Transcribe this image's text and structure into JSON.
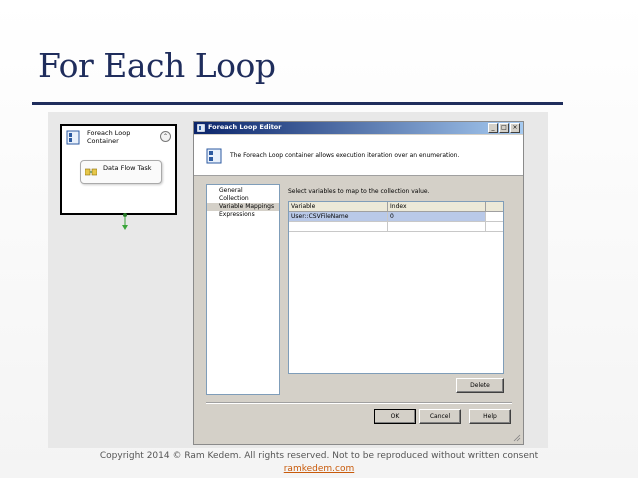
{
  "slide": {
    "title": "For Each Loop",
    "copyright": "Copyright 2014 © Ram Kedem. All rights reserved. Not to be reproduced without written consent",
    "link": "ramkedem.com"
  },
  "control_flow": {
    "container_label": "Foreach Loop Container",
    "task_label": "Data Flow Task"
  },
  "dialog": {
    "title": "Foreach Loop Editor",
    "header_text": "The Foreach Loop container allows execution iteration over an enumeration.",
    "nav_items": [
      {
        "label": "General"
      },
      {
        "label": "Collection"
      },
      {
        "label": "Variable Mappings"
      },
      {
        "label": "Expressions"
      }
    ],
    "instruction": "Select variables to map to the collection value.",
    "grid": {
      "columns": [
        "Variable",
        "Index"
      ],
      "rows": [
        {
          "variable": "User::CSVFileName",
          "index": "0"
        },
        {
          "variable": "",
          "index": ""
        }
      ]
    },
    "buttons": {
      "delete": "Delete",
      "ok": "OK",
      "cancel": "Cancel",
      "help": "Help"
    }
  },
  "colors": {
    "title": "#1f2d5c",
    "titlebar": "#0a246a",
    "selection": "#b9c9e8",
    "link": "#c85a0a"
  }
}
